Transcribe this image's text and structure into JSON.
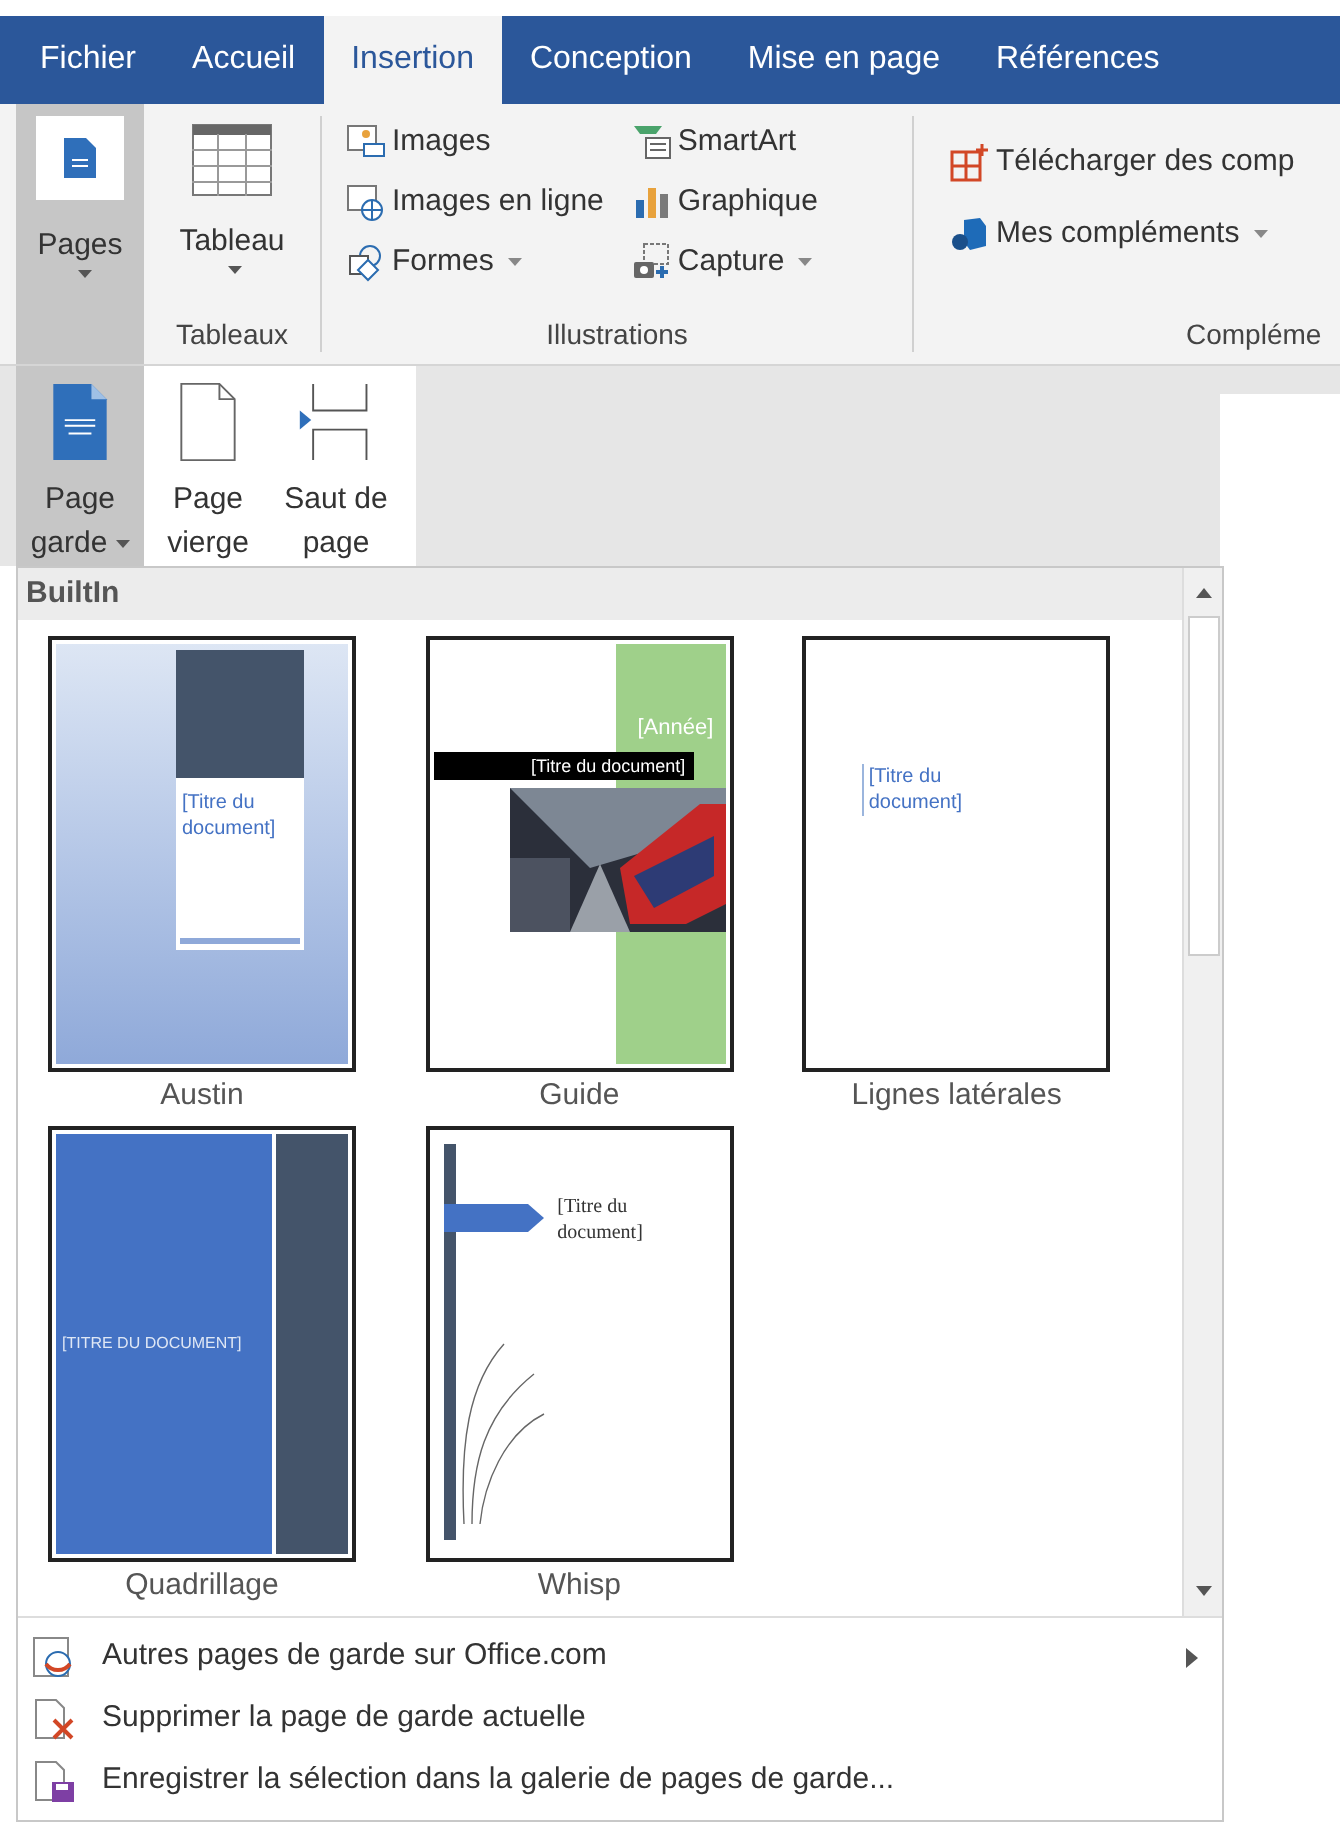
{
  "tabs": [
    {
      "label": "Fichier",
      "selected": false
    },
    {
      "label": "Accueil",
      "selected": false
    },
    {
      "label": "Insertion",
      "selected": true
    },
    {
      "label": "Conception",
      "selected": false
    },
    {
      "label": "Mise en page",
      "selected": false
    },
    {
      "label": "Références",
      "selected": false
    }
  ],
  "ribbon": {
    "pages_button": {
      "label": "Pages",
      "selected": true
    },
    "table_group": {
      "label": "Tableaux",
      "button": "Tableau"
    },
    "illustrations": {
      "label": "Illustrations",
      "items": [
        {
          "label": "Images",
          "kind": "images",
          "dropdown": false
        },
        {
          "label": "Images en ligne",
          "kind": "online",
          "dropdown": false
        },
        {
          "label": "Formes",
          "kind": "shapes",
          "dropdown": true
        },
        {
          "label": "SmartArt",
          "kind": "smartart",
          "dropdown": false
        },
        {
          "label": "Graphique",
          "kind": "chart",
          "dropdown": false
        },
        {
          "label": "Capture",
          "kind": "capture",
          "dropdown": true
        }
      ]
    },
    "addins": {
      "label": "Compléme",
      "items": [
        {
          "label": "Télécharger des comp",
          "kind": "store",
          "dropdown": false
        },
        {
          "label": "Mes compléments",
          "kind": "mine",
          "dropdown": true
        }
      ]
    }
  },
  "pages_menu": [
    {
      "lines": [
        "Page",
        "garde"
      ],
      "dropdown": true,
      "selected": true,
      "kind": "cover"
    },
    {
      "lines": [
        "Page",
        "vierge"
      ],
      "dropdown": false,
      "selected": false,
      "kind": "blank"
    },
    {
      "lines": [
        "Saut de",
        "page"
      ],
      "dropdown": false,
      "selected": false,
      "kind": "break"
    }
  ],
  "gallery": {
    "section": "BuiltIn",
    "templates": [
      {
        "name": "Austin",
        "kind": "austin",
        "title": "[Titre du document]"
      },
      {
        "name": "Guide",
        "kind": "guide",
        "year": "[Année]",
        "title": "[Titre du document]"
      },
      {
        "name": "Lignes latérales",
        "kind": "lateral",
        "title": "[Titre du document]"
      },
      {
        "name": "Quadrillage",
        "kind": "grid",
        "title": "[TITRE DU DOCUMENT]"
      },
      {
        "name": "Whisp",
        "kind": "whisp",
        "title": "[Titre du document]"
      }
    ]
  },
  "footer_menu": [
    {
      "label": "Autres pages de garde sur Office.com",
      "kind": "online",
      "submenu": true
    },
    {
      "label": "Supprimer la page de garde actuelle",
      "kind": "remove",
      "submenu": false
    },
    {
      "label": "Enregistrer la sélection dans la galerie de pages de garde...",
      "kind": "save",
      "submenu": false
    }
  ]
}
